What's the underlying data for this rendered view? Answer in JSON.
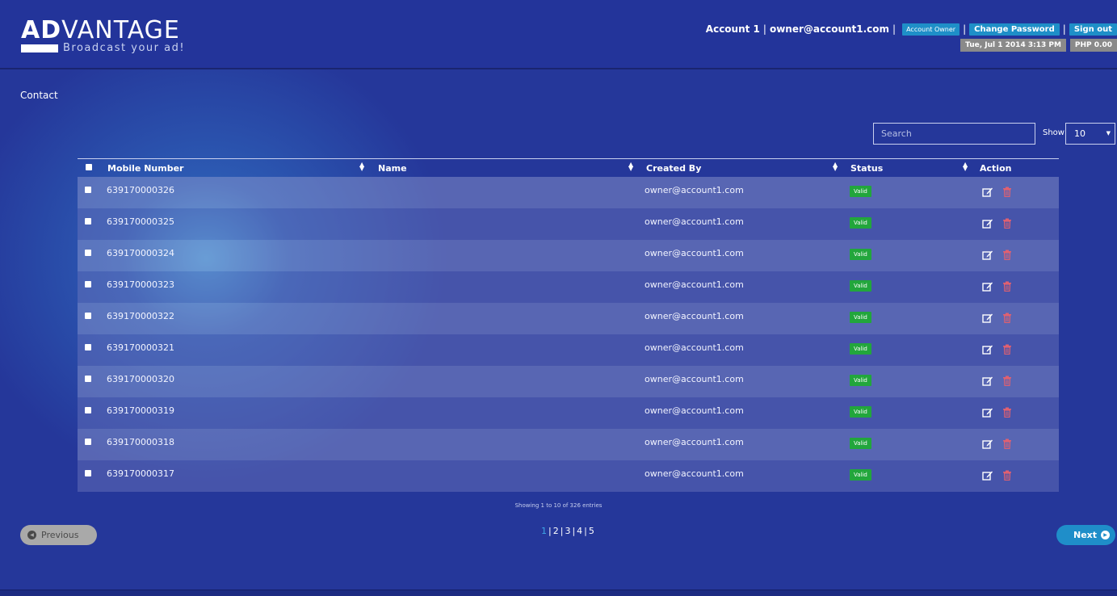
{
  "brand": {
    "name_bold": "AD",
    "name_rest": "VANTAGE",
    "tagline": "Broadcast your ad!"
  },
  "user": {
    "account": "Account 1",
    "email": "owner@account1.com",
    "role": "Account Owner",
    "change_password": "Change Password",
    "sign_out": "Sign out",
    "datetime": "Tue, Jul 1 2014 3:13 PM",
    "balance": "PHP 0.00"
  },
  "page": {
    "title": "Contact"
  },
  "controls": {
    "search_placeholder": "Search",
    "show_label": "Show",
    "show_value": "10"
  },
  "table": {
    "columns": [
      "Mobile Number",
      "Name",
      "Created By",
      "Status",
      "Action"
    ],
    "rows": [
      {
        "mobile": "639170000326",
        "name": "",
        "created_by": "owner@account1.com",
        "status": "Valid"
      },
      {
        "mobile": "639170000325",
        "name": "",
        "created_by": "owner@account1.com",
        "status": "Valid"
      },
      {
        "mobile": "639170000324",
        "name": "",
        "created_by": "owner@account1.com",
        "status": "Valid"
      },
      {
        "mobile": "639170000323",
        "name": "",
        "created_by": "owner@account1.com",
        "status": "Valid"
      },
      {
        "mobile": "639170000322",
        "name": "",
        "created_by": "owner@account1.com",
        "status": "Valid"
      },
      {
        "mobile": "639170000321",
        "name": "",
        "created_by": "owner@account1.com",
        "status": "Valid"
      },
      {
        "mobile": "639170000320",
        "name": "",
        "created_by": "owner@account1.com",
        "status": "Valid"
      },
      {
        "mobile": "639170000319",
        "name": "",
        "created_by": "owner@account1.com",
        "status": "Valid"
      },
      {
        "mobile": "639170000318",
        "name": "",
        "created_by": "owner@account1.com",
        "status": "Valid"
      },
      {
        "mobile": "639170000317",
        "name": "",
        "created_by": "owner@account1.com",
        "status": "Valid"
      }
    ]
  },
  "pagination": {
    "info": "Showing 1 to 10 of 326 entries",
    "previous": "Previous",
    "next": "Next",
    "pages": [
      "1",
      "2",
      "3",
      "4",
      "5"
    ],
    "current": "1"
  },
  "colors": {
    "background": "#25379a",
    "accent": "#1f8ec9",
    "valid": "#22a63c",
    "delete": "#e06070"
  }
}
